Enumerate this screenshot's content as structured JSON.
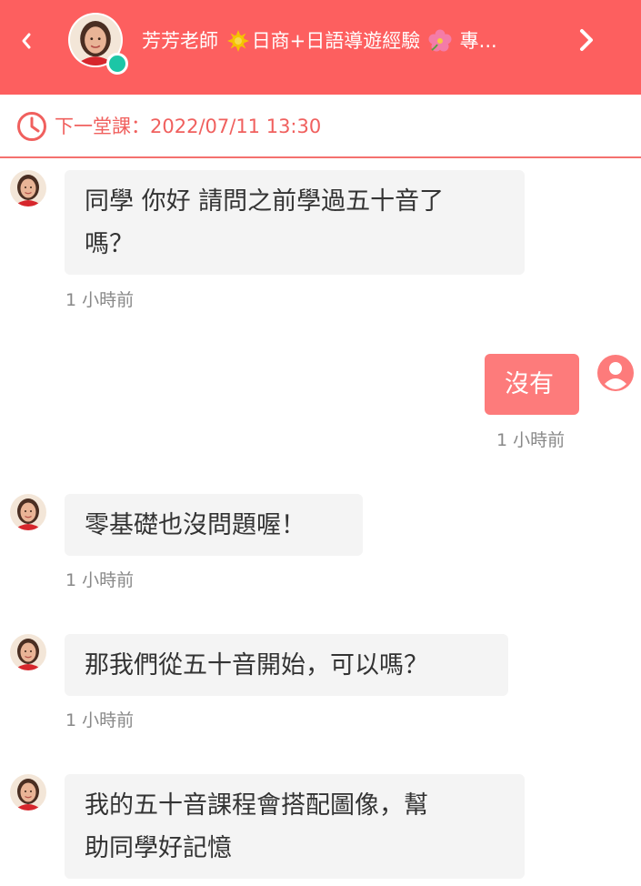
{
  "header": {
    "back_icon": "chevron-left-icon",
    "forward_icon": "chevron-right-icon",
    "title_name": "芳芳老師",
    "title_part1": "日商+日語導遊經驗",
    "title_part2": "專...",
    "status": "online",
    "bg_color": "#fd5f5f"
  },
  "next_lesson": {
    "icon": "clock-icon",
    "text": "下一堂課：2022/07/11 13:30",
    "color": "#f0605e"
  },
  "messages": [
    {
      "from": "teacher",
      "line1": "同學 你好 請問之前學過五十音了",
      "line2": "嗎？",
      "time": "1 小時前"
    },
    {
      "from": "me",
      "line1": "沒有",
      "time": "1 小時前"
    },
    {
      "from": "teacher",
      "line1": "零基礎也沒問題喔！",
      "time": "1 小時前"
    },
    {
      "from": "teacher",
      "line1": "那我們從五十音開始，可以嗎？",
      "time": "1 小時前"
    },
    {
      "from": "teacher",
      "line1": "我的五十音課程會搭配圖像，幫",
      "line2": "助同學好記憶"
    }
  ]
}
